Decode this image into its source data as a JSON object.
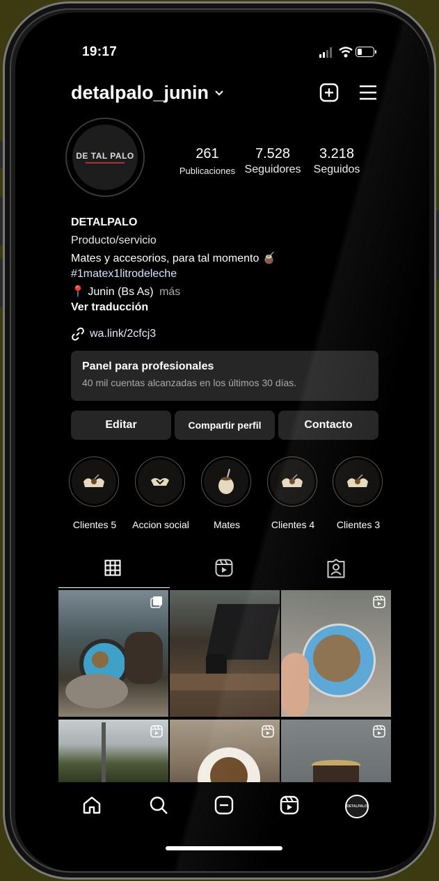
{
  "status_bar": {
    "time": "19:17"
  },
  "profile": {
    "username": "detalpalo_junin",
    "avatar_text": "DE TAL PALO",
    "stats": [
      {
        "value": "261",
        "label": "Publicaciones"
      },
      {
        "value": "7.528",
        "label": "Seguidores"
      },
      {
        "value": "3.218",
        "label": "Seguidos"
      }
    ],
    "name": "DETALPALO",
    "category": "Producto/servicio",
    "bio_line1": "Mates y accesorios, para tal momento 🧉",
    "hashtag": "#1matex1litrodeleche",
    "location": "📍 Junin (Bs As)",
    "more": "más",
    "translate": "Ver traducción",
    "link": "wa.link/2cfcj3"
  },
  "pro_panel": {
    "title": "Panel para profesionales",
    "subtitle": "40 mil cuentas alcanzadas en los últimos 30 días."
  },
  "actions": {
    "edit": "Editar",
    "share": "Compartir perfil",
    "contact": "Contacto"
  },
  "highlights": [
    {
      "label": "Clientes 5"
    },
    {
      "label": "Accion social"
    },
    {
      "label": "Mates"
    },
    {
      "label": "Clientes 4"
    },
    {
      "label": "Clientes 3"
    }
  ],
  "tabs": [
    "grid-icon",
    "reels-icon",
    "tagged-icon"
  ],
  "bottom_nav": [
    "home-icon",
    "search-icon",
    "new-post-icon",
    "reels-icon",
    "profile-avatar"
  ],
  "bottom_nav_avatar_text": "DETALPALO",
  "colors": {
    "background": "#000000",
    "surface": "#262626",
    "secondary_text": "#aaaaaa"
  }
}
